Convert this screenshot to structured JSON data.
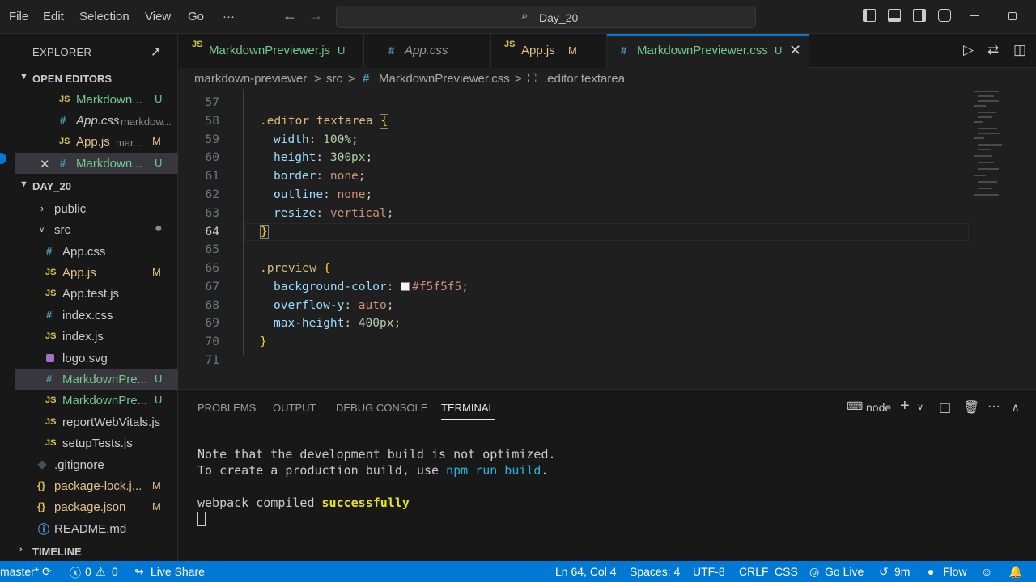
{
  "menu": [
    "File",
    "Edit",
    "Selection",
    "View",
    "Go",
    "···"
  ],
  "search": {
    "text": "Day_20"
  },
  "explorer": {
    "title": "EXPLORER",
    "open_editors_title": "OPEN EDITORS",
    "open_editors": [
      {
        "icon": "JS",
        "name": "Markdown...",
        "sub": "",
        "badge": "U"
      },
      {
        "icon": "#",
        "name": "App.css",
        "sub": "markdow...",
        "badge": ""
      },
      {
        "icon": "JS",
        "name": "App.js",
        "sub": "mar...",
        "badge": "M"
      },
      {
        "icon": "#",
        "name": "Markdown...",
        "sub": "",
        "badge": "U"
      }
    ],
    "folder_title": "DAY_20",
    "tree": [
      {
        "icon": ">",
        "name": "public",
        "badge": ""
      },
      {
        "icon": "v",
        "name": "src",
        "badge": ""
      },
      {
        "icon": "#",
        "name": "App.css",
        "badge": ""
      },
      {
        "icon": "JS",
        "name": "App.js",
        "badge": "M"
      },
      {
        "icon": "JS",
        "name": "App.test.js",
        "badge": ""
      },
      {
        "icon": "#",
        "name": "index.css",
        "badge": ""
      },
      {
        "icon": "JS",
        "name": "index.js",
        "badge": ""
      },
      {
        "icon": "svg",
        "name": "logo.svg",
        "badge": ""
      },
      {
        "icon": "#",
        "name": "MarkdownPre...",
        "badge": "U"
      },
      {
        "icon": "JS",
        "name": "MarkdownPre...",
        "badge": "U"
      },
      {
        "icon": "JS",
        "name": "reportWebVitals.js",
        "badge": ""
      },
      {
        "icon": "JS",
        "name": "setupTests.js",
        "badge": ""
      },
      {
        "icon": "git",
        "name": ".gitignore",
        "badge": ""
      },
      {
        "icon": "{}",
        "name": "package-lock.j...",
        "badge": "M"
      },
      {
        "icon": "{}",
        "name": "package.json",
        "badge": "M"
      },
      {
        "icon": "i",
        "name": "README.md",
        "badge": ""
      }
    ],
    "timeline_title": "TIMELINE"
  },
  "tabs": [
    {
      "icon": "JS",
      "name": "MarkdownPreviewer.js",
      "badge": "U"
    },
    {
      "icon": "#",
      "name": "App.css",
      "badge": ""
    },
    {
      "icon": "JS",
      "name": "App.js",
      "badge": "M"
    },
    {
      "icon": "#",
      "name": "MarkdownPreviewer.css",
      "badge": "U"
    }
  ],
  "breadcrumb": [
    "markdown-previewer",
    ">",
    "src",
    ">",
    "#",
    "MarkdownPreviewer.css",
    ">",
    ".editor textarea"
  ],
  "code": {
    "line_numbers": [
      "57",
      "58",
      "59",
      "60",
      "61",
      "62",
      "63",
      "64",
      "65",
      "66",
      "67",
      "68",
      "69",
      "70",
      "71"
    ],
    "l58_sel": ".editor textarea ",
    "l58_brace": "{",
    "l59_prop": "width",
    "l59_val": "100%",
    "l60_prop": "height",
    "l60_val": "300px",
    "l61_prop": "border",
    "l61_val": "none",
    "l62_prop": "outline",
    "l62_val": "none",
    "l63_prop": "resize",
    "l63_val": "vertical",
    "l64_brace": "}",
    "l66_sel": ".preview ",
    "l66_brace": "{",
    "l67_prop": "background-color",
    "l67_val": "#f5f5f5",
    "l68_prop": "overflow-y",
    "l68_val": "auto",
    "l69_prop": "max-height",
    "l69_val": "400px",
    "l70_brace": "}"
  },
  "panel": {
    "tabs": [
      "PROBLEMS",
      "OUTPUT",
      "DEBUG CONSOLE",
      "TERMINAL"
    ],
    "shell": "node",
    "line1": "Note that the development build is not optimized.",
    "line2_a": "To create a production build, use ",
    "line2_b": "npm run build",
    "line2_c": ".",
    "line3_a": "webpack compiled ",
    "line3_b": "successfully"
  },
  "status": {
    "branch": "master*",
    "errors": "0",
    "warnings": "0",
    "live_share": "Live Share",
    "position": "Ln 64, Col 4",
    "spaces": "Spaces: 4",
    "encoding": "UTF-8",
    "eol": "CRLF",
    "language": "CSS",
    "go_live": "Go Live",
    "timer": "9m",
    "flow": "Flow"
  },
  "colors": {
    "accent": "#0078d4",
    "untracked": "#73c991",
    "modified": "#e2c08d"
  }
}
